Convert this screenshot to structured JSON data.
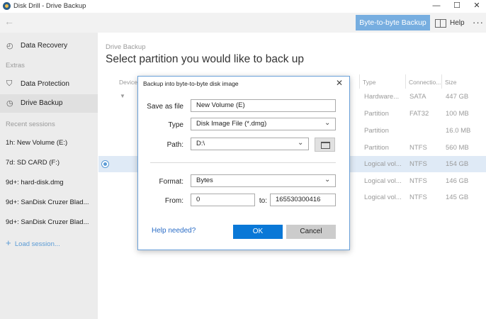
{
  "window": {
    "title": "Disk Drill - Drive Backup",
    "min": "—",
    "max": "☐",
    "close": "✕"
  },
  "toolbar": {
    "back": "←",
    "btb_backup": "Byte-to-byte Backup",
    "help": "Help",
    "more": "···"
  },
  "sidebar": {
    "items": [
      {
        "icon": "◴",
        "label": "Data Recovery"
      },
      {
        "icon": "⛉",
        "label": "Data Protection"
      },
      {
        "icon": "◷",
        "label": "Drive Backup"
      }
    ],
    "extras_label": "Extras",
    "recent_label": "Recent sessions",
    "sessions": [
      "1h: New Volume (E:)",
      "7d: SD CARD (F:)",
      "9d+: hard-disk.dmg",
      "9d+: SanDisk Cruzer Blad...",
      "9d+: SanDisk Cruzer Blad..."
    ],
    "load_session": "Load session..."
  },
  "main": {
    "breadcrumb": "Drive Backup",
    "title": "Select partition you would like to back up",
    "columns": {
      "device": "Device",
      "type": "Type",
      "connection": "Connectio...",
      "size": "Size"
    },
    "rows": [
      {
        "type": "Hardware...",
        "conn": "SATA",
        "size": "447 GB"
      },
      {
        "type": "Partition",
        "conn": "FAT32",
        "size": "100 MB"
      },
      {
        "type": "Partition",
        "conn": "",
        "size": "16.0 MB"
      },
      {
        "type": "Partition",
        "conn": "NTFS",
        "size": "560 MB"
      },
      {
        "type": "Logical vol...",
        "conn": "NTFS",
        "size": "154 GB"
      },
      {
        "type": "Logical vol...",
        "conn": "NTFS",
        "size": "146 GB"
      },
      {
        "type": "Logical vol...",
        "conn": "NTFS",
        "size": "145 GB"
      }
    ]
  },
  "dialog": {
    "title": "Backup into byte-to-byte disk image",
    "close": "✕",
    "save_as_label": "Save as file",
    "save_as_value": "New Volume (E)",
    "type_label": "Type",
    "type_value": "Disk Image File (*.dmg)",
    "path_label": "Path:",
    "path_value": "D:\\",
    "format_label": "Format:",
    "format_value": "Bytes",
    "from_label": "From:",
    "from_value": "0",
    "to_label": "to:",
    "to_value": "165530300416",
    "help_link": "Help needed?",
    "ok": "OK",
    "cancel": "Cancel"
  },
  "colors": {
    "accent": "#77aee0",
    "primary_button": "#0a78d7",
    "link": "#2a6cc6",
    "selection": "#dfeaf6"
  }
}
